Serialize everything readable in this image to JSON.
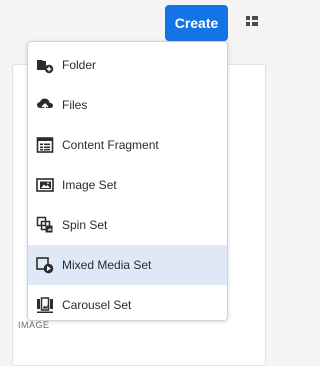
{
  "toolbar": {
    "create_label": "Create"
  },
  "menu": {
    "items": [
      {
        "label": "Folder",
        "icon": "folder-add-icon"
      },
      {
        "label": "Files",
        "icon": "cloud-upload-icon"
      },
      {
        "label": "Content Fragment",
        "icon": "content-fragment-icon"
      },
      {
        "label": "Image Set",
        "icon": "image-set-icon"
      },
      {
        "label": "Spin Set",
        "icon": "spin-set-icon"
      },
      {
        "label": "Mixed Media Set",
        "icon": "mixed-media-set-icon",
        "selected": true
      },
      {
        "label": "Carousel Set",
        "icon": "carousel-set-icon"
      }
    ]
  },
  "background": {
    "caption": "IMAGE"
  },
  "colors": {
    "accent": "#1473e6",
    "selected_row": "#dfe8f7",
    "icon": "#2c2c2c"
  }
}
